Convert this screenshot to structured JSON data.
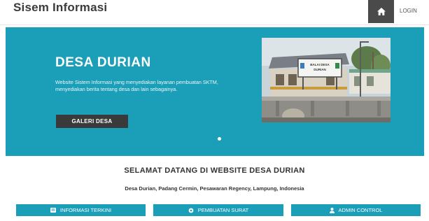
{
  "navbar": {
    "brand": "Sisem Informasi",
    "home_icon": "home-icon",
    "login_label": "LOGIN"
  },
  "hero": {
    "title": "DESA DURIAN",
    "description": "Website Sistem Informasi yang menyediakan layanan pembuatan SKTM, menyediakan berita tentang desa dan lain sebagainya.",
    "button_label": "GALERI DESA",
    "photo_sign_line1": "BALAI DESA",
    "photo_sign_line2": "DURIAN"
  },
  "welcome": {
    "title": "SELAMAT DATANG DI WEBSITE DESA DURIAN",
    "location": "Desa Durian, Padang Cermin, Pesawaran Regency, Lampung, Indonesia"
  },
  "features": [
    {
      "label": "INFORMASI TERKINI",
      "icon": "newspaper-icon"
    },
    {
      "label": "PEMBUATAN SURAT",
      "icon": "gear-icon"
    },
    {
      "label": "ADMIN CONTROL",
      "icon": "user-icon"
    }
  ],
  "colors": {
    "accent": "#1b9eb8",
    "dark": "#3a3a3a",
    "text": "#333333"
  }
}
